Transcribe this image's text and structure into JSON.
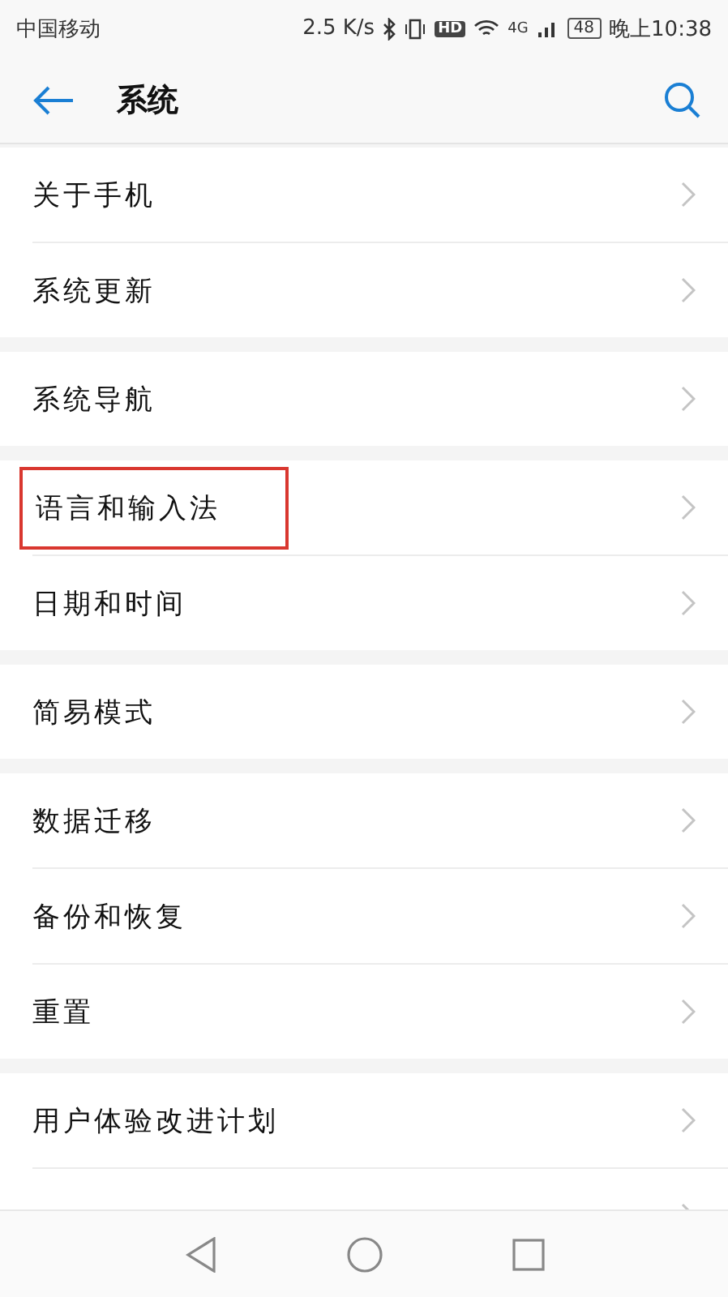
{
  "status_bar": {
    "carrier": "中国移动",
    "speed": "2.5 K/s",
    "hd": "HD",
    "network": "4G",
    "battery": "48",
    "time": "晚上10:38"
  },
  "header": {
    "title": "系统"
  },
  "groups": [
    {
      "items": [
        {
          "label": "关于手机",
          "highlighted": false
        },
        {
          "label": "系统更新",
          "highlighted": false
        }
      ]
    },
    {
      "items": [
        {
          "label": "系统导航",
          "highlighted": false
        }
      ]
    },
    {
      "items": [
        {
          "label": "语言和输入法",
          "highlighted": true
        },
        {
          "label": "日期和时间",
          "highlighted": false
        }
      ]
    },
    {
      "items": [
        {
          "label": "简易模式",
          "highlighted": false
        }
      ]
    },
    {
      "items": [
        {
          "label": "数据迁移",
          "highlighted": false
        },
        {
          "label": "备份和恢复",
          "highlighted": false
        },
        {
          "label": "重置",
          "highlighted": false
        }
      ]
    },
    {
      "items": [
        {
          "label": "用户体验改进计划",
          "highlighted": false
        },
        {
          "highlighted": false
        }
      ]
    }
  ]
}
